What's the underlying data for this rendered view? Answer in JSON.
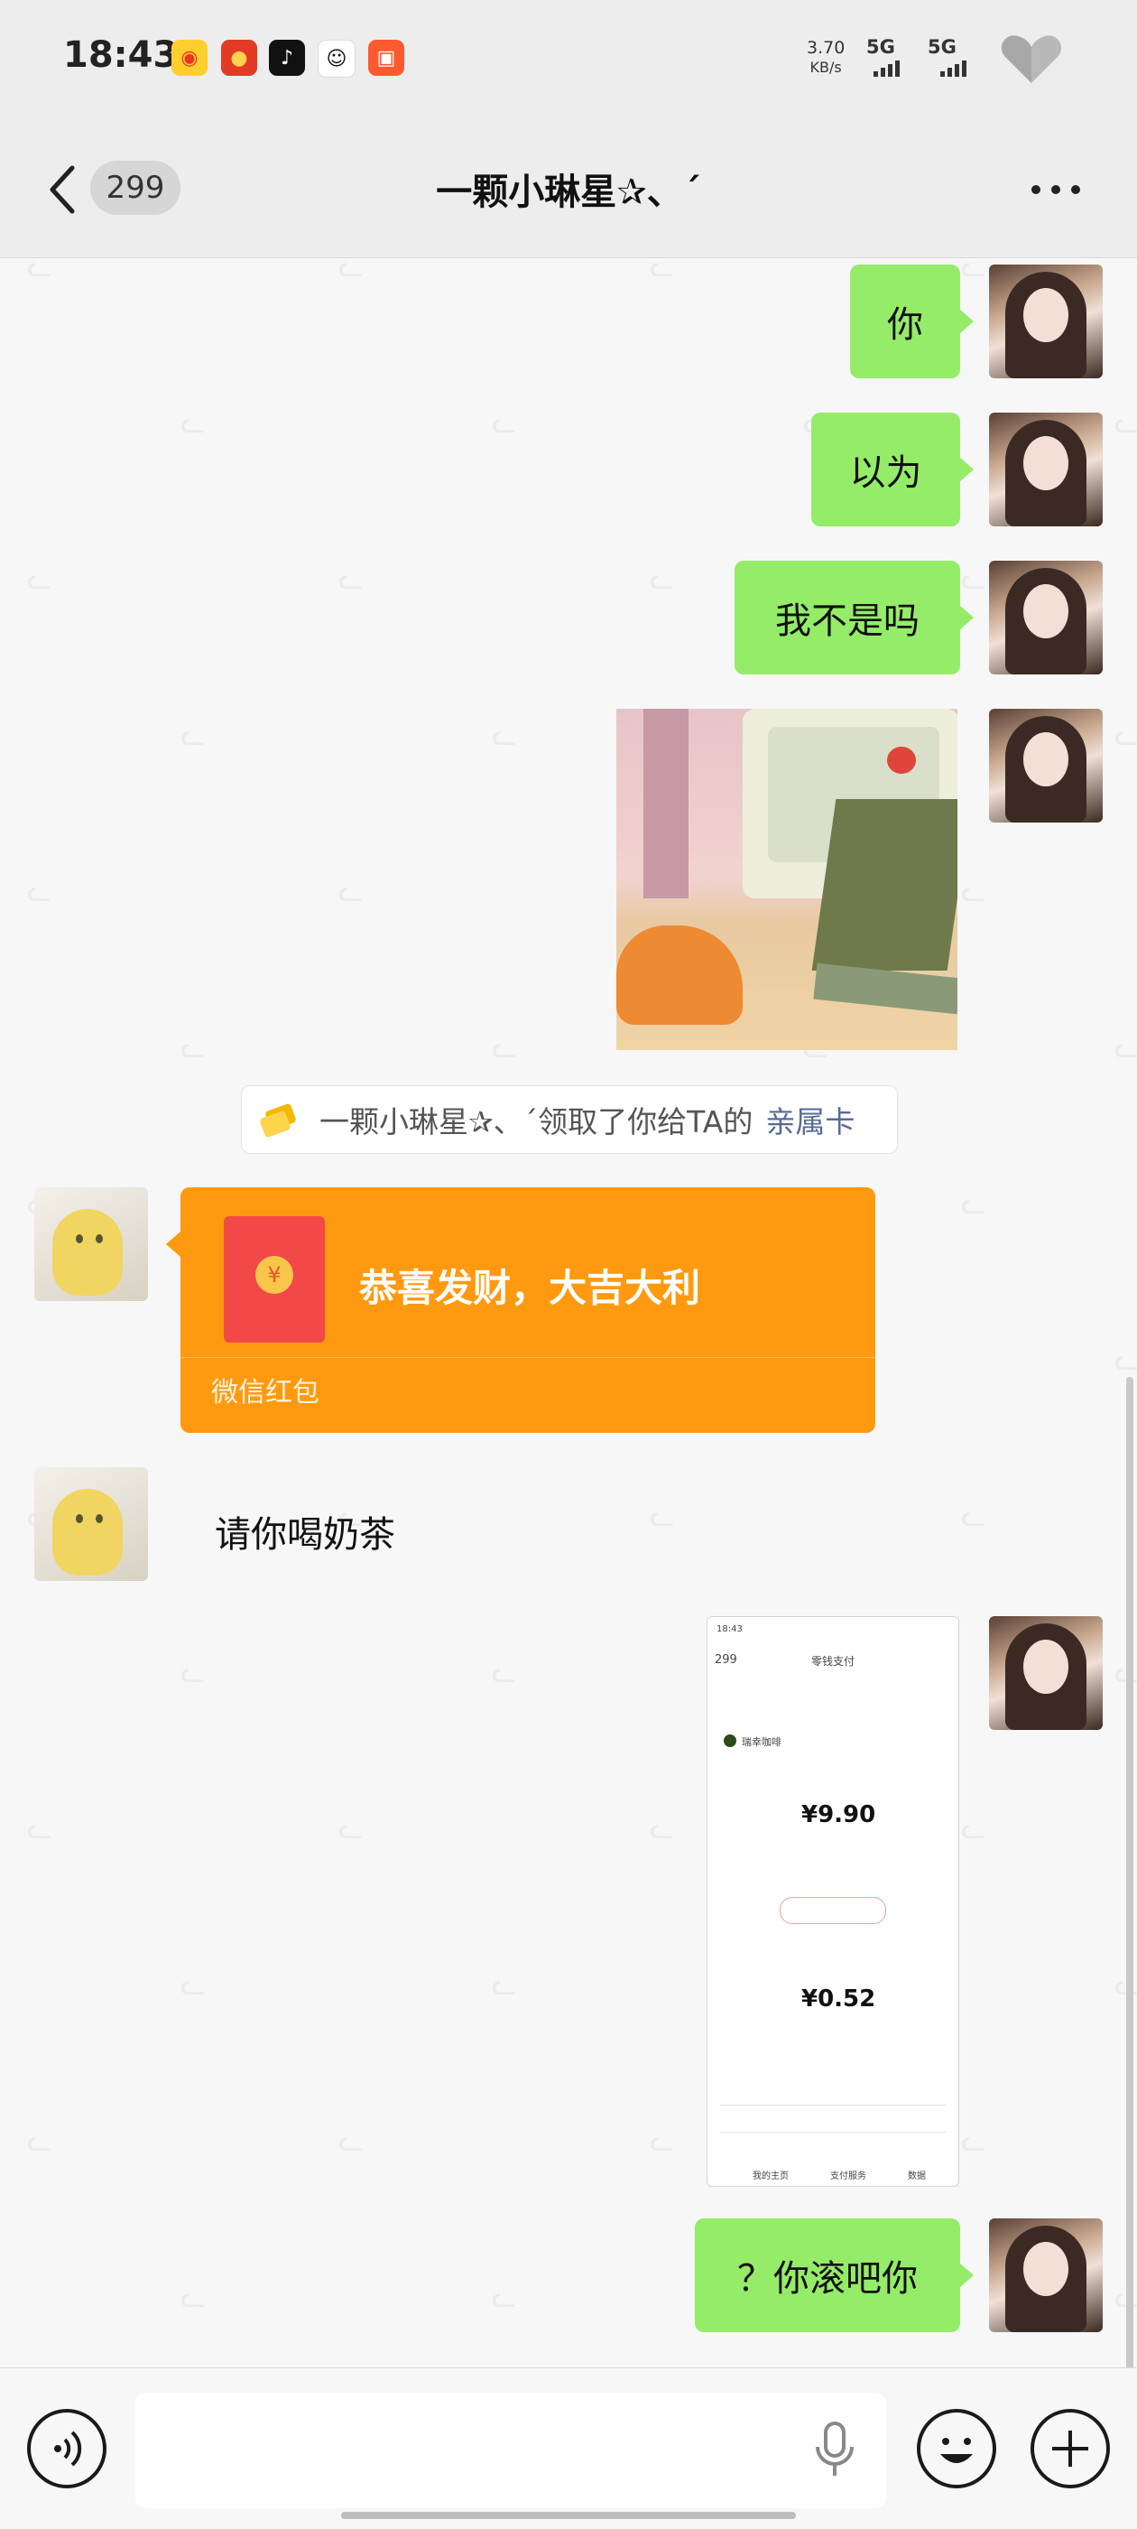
{
  "status_bar": {
    "time": "18:43",
    "app_icons": [
      "weibo-icon",
      "red-packet-app-icon",
      "tiktok-icon",
      "qq-icon",
      "kuaishou-icon"
    ],
    "net_speed_value": "3.70",
    "net_speed_unit": "KB/s",
    "signal_1": "5G",
    "signal_2": "5G",
    "battery_icon": "heart-battery-icon"
  },
  "nav": {
    "unread_count": "299",
    "title": "一颗小琳星✰、ˊ",
    "more_icon": "more-dots-icon"
  },
  "messages": [
    {
      "from": "me",
      "type": "text",
      "text": "你"
    },
    {
      "from": "me",
      "type": "text",
      "text": "以为"
    },
    {
      "from": "me",
      "type": "text",
      "text": "我不是吗"
    },
    {
      "from": "me",
      "type": "image"
    },
    {
      "type": "system",
      "text": "一颗小琳星✰、ˊ领取了你给TA的",
      "link": "亲属卡"
    },
    {
      "from": "them",
      "type": "red_packet",
      "title": "恭喜发财，大吉大利",
      "label": "微信红包"
    },
    {
      "from": "them",
      "type": "text",
      "text": "请你喝奶茶"
    },
    {
      "from": "me",
      "type": "screenshot",
      "screenshot_text": {
        "badge": "299",
        "header": "零钱支付",
        "amount_1": "¥9.90",
        "amount_2": "¥0.52",
        "merchant": "瑞幸咖啡",
        "tab_1": "我的主页",
        "tab_2": "支付服务",
        "tab_3": "数据"
      }
    },
    {
      "from": "me",
      "type": "text",
      "text": "？你滚吧你"
    }
  ],
  "input_bar": {
    "voice_icon": "voice-toggle-icon",
    "mic_icon": "microphone-icon",
    "emoji_icon": "emoji-icon",
    "plus_icon": "plus-icon"
  },
  "colors": {
    "bubble_green": "#95ec69",
    "red_packet_orange": "#ff9a10",
    "link_blue": "#576b95"
  }
}
